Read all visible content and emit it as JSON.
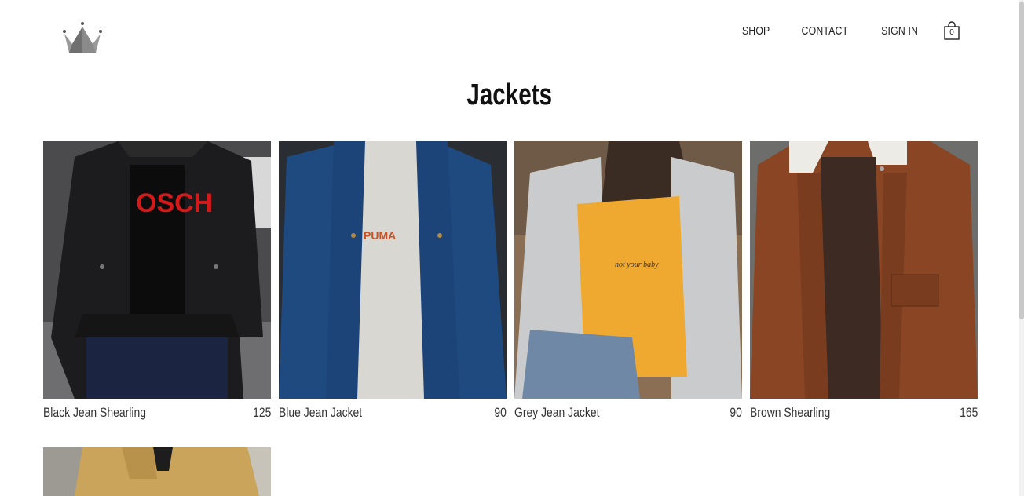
{
  "header": {
    "nav": {
      "shop": "SHOP",
      "contact": "CONTACT",
      "sign_in": "SIGN IN"
    },
    "cart_count": "0"
  },
  "page_title": "Jackets",
  "products": [
    {
      "name": "Black Jean Shearling",
      "price": "125"
    },
    {
      "name": "Blue Jean Jacket",
      "price": "90"
    },
    {
      "name": "Grey Jean Jacket",
      "price": "90"
    },
    {
      "name": "Brown Shearling",
      "price": "165"
    },
    {
      "name": "",
      "price": ""
    }
  ],
  "colors": {
    "logo": "#7a7a7a",
    "text": "#222222",
    "background": "#ffffff"
  },
  "icons": {
    "logo": "crown-logo-icon",
    "cart": "shopping-bag-icon"
  }
}
